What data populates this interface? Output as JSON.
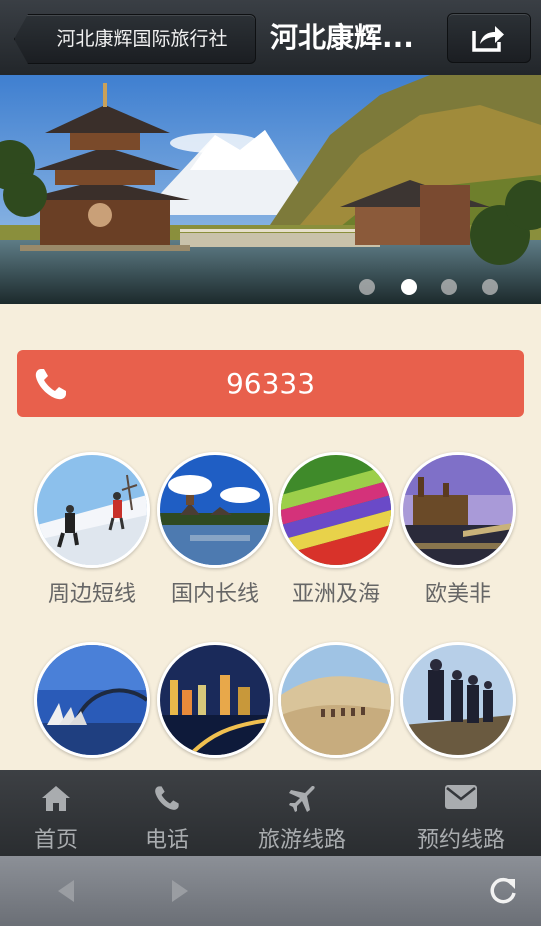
{
  "header": {
    "back_label": "河北康辉国际旅行社",
    "title": "河北康辉..."
  },
  "banner": {
    "slide_count": 4,
    "active_slide": 2
  },
  "call": {
    "phone": "96333",
    "icon": "phone-icon"
  },
  "categories": [
    {
      "label": "周边短线",
      "image": "skiing"
    },
    {
      "label": "国内长线",
      "image": "pagoda-lake"
    },
    {
      "label": "亚洲及海",
      "image": "flower-fields"
    },
    {
      "label": "欧美非",
      "image": "castle-river"
    },
    {
      "label": "",
      "image": "sydney-opera-house"
    },
    {
      "label": "",
      "image": "city-night"
    },
    {
      "label": "",
      "image": "desert-camels"
    },
    {
      "label": "",
      "image": "hikers"
    }
  ],
  "tabbar": {
    "items": [
      {
        "label": "首页",
        "icon": "home-icon"
      },
      {
        "label": "电话",
        "icon": "phone-icon"
      },
      {
        "label": "旅游线路",
        "icon": "plane-icon"
      },
      {
        "label": "预约线路",
        "icon": "mail-icon"
      }
    ]
  },
  "browser": {
    "back_icon": "back-arrow-icon",
    "forward_icon": "forward-arrow-icon",
    "refresh_icon": "refresh-icon"
  }
}
